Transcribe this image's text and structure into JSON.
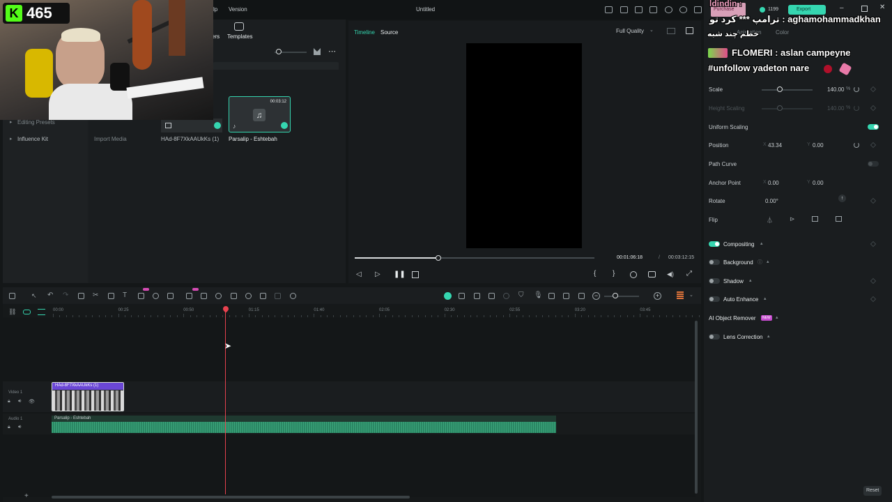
{
  "window": {
    "title": "Untitled",
    "menu": [
      "lp",
      "Version"
    ],
    "purchase_label": "Purchase",
    "credits": "1199",
    "export_label": "Export"
  },
  "media": {
    "tabs": [
      "ers",
      "Templates"
    ],
    "sidebar": [
      "Editing Presets",
      "Influence Kit"
    ],
    "import_label": "Import Media",
    "items": [
      {
        "name": "HAd-8F7XkAAUkKs (1)",
        "duration": ""
      },
      {
        "name": "Parsalip - Eshtebah",
        "duration": "00:03:12"
      }
    ]
  },
  "preview": {
    "tabs": [
      "Timeline",
      "Source"
    ],
    "quality": "Full Quality",
    "current_time": "00:01:06:18",
    "separator": "/",
    "total_time": "00:03:12:15",
    "progress": 0.35
  },
  "properties": {
    "tabs": [
      "Animation",
      "Color"
    ],
    "rows": {
      "scale": {
        "label": "Scale",
        "value": "140.00",
        "unit": "%"
      },
      "height_scaling": {
        "label": "Height Scaling",
        "value": "140.00",
        "unit": "%"
      },
      "uniform_scaling": {
        "label": "Uniform Scaling"
      },
      "position": {
        "label": "Position",
        "x_axis": "X",
        "x": "43.34",
        "y_axis": "Y",
        "y": "0.00"
      },
      "path_curve": {
        "label": "Path Curve"
      },
      "anchor": {
        "label": "Anchor Point",
        "x_axis": "X",
        "x": "0.00",
        "y_axis": "Y",
        "y": "0.00"
      },
      "rotate": {
        "label": "Rotate",
        "value": "0.00°"
      },
      "flip": {
        "label": "Flip"
      }
    },
    "sections": [
      {
        "label": "Compositing",
        "on": true
      },
      {
        "label": "Background",
        "on": false
      },
      {
        "label": "Shadow",
        "on": false
      },
      {
        "label": "Auto Enhance",
        "on": false
      },
      {
        "label": "AI Object Remover",
        "badge": "NEW"
      },
      {
        "label": "Lens Correction",
        "on": false
      }
    ],
    "reset_label": "Reset"
  },
  "timeline": {
    "ruler": [
      "00:00",
      "00:25",
      "00:50",
      "01:15",
      "01:40",
      "02:05",
      "02:30",
      "02:55",
      "03:20",
      "03:45"
    ],
    "tracks": [
      {
        "label": "Video 1",
        "clip": "HAd-8F7XkAAUkKs (1)"
      },
      {
        "label": "Audio 1",
        "clip": "Parsalip - Eshtebah"
      }
    ],
    "add_label": "+"
  },
  "stream": {
    "viewer_count": "465",
    "chat": [
      "ldindin :",
      "ترامپ *** کرد تو : aghamohammadkhan",
      "خطم چند شبه",
      "FLOMERI : aslan campeyne",
      "#unfollow yadeton nare"
    ]
  },
  "colors": {
    "accent": "#35d6b0",
    "playhead": "#e8424f",
    "video_clip": "#6b47d6",
    "audio_wave": "#2f8f6a"
  }
}
